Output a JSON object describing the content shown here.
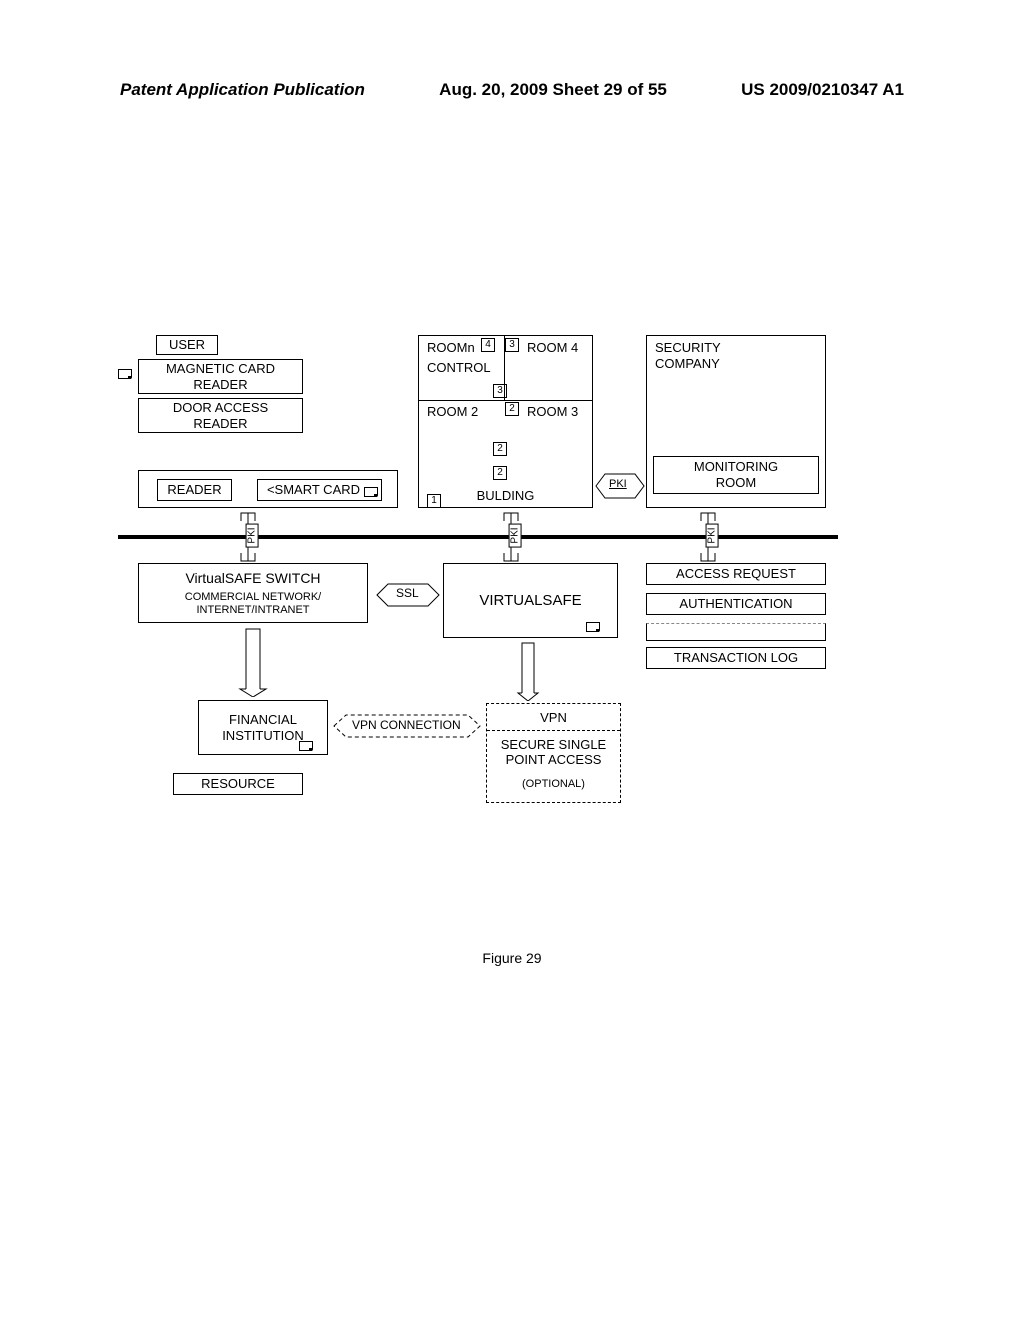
{
  "header": {
    "left": "Patent Application Publication",
    "center": "Aug. 20, 2009  Sheet 29 of 55",
    "right": "US 2009/0210347 A1"
  },
  "blocks": {
    "user": "USER",
    "mag_reader": "MAGNETIC CARD\nREADER",
    "door_reader": "DOOR ACCESS\nREADER",
    "reader": "READER",
    "smart_card": "<SMART CARD",
    "roomn": "ROOMn",
    "control": "CONTROL",
    "room2": "ROOM 2",
    "room3": "ROOM 3",
    "room4": "ROOM 4",
    "building": "BULDING",
    "security_company": "SECURITY\nCOMPANY",
    "monitoring_room": "MONITORING\nROOM",
    "vswitch_title": "VirtualSAFE SWITCH",
    "vswitch_sub": "COMMERCIAL NETWORK/\nINTERNET/INTRANET",
    "virtualsafe": "VIRTUALSAFE",
    "access_request": "ACCESS REQUEST",
    "authentication": "AUTHENTICATION",
    "transaction_log": "TRANSACTION LOG",
    "financial": "FINANCIAL\nINSTITUTION",
    "resource": "RESOURCE",
    "vpn": "VPN",
    "secure_single": "SECURE SINGLE\nPOINT ACCESS",
    "optional": "(OPTIONAL)"
  },
  "connectors": {
    "ssl": "SSL",
    "vpn_conn": "VPN CONNECTION",
    "pki": "PKI"
  },
  "nums": {
    "n1": "1",
    "n2": "2",
    "n3": "3",
    "n4": "4"
  },
  "caption": "Figure 29"
}
